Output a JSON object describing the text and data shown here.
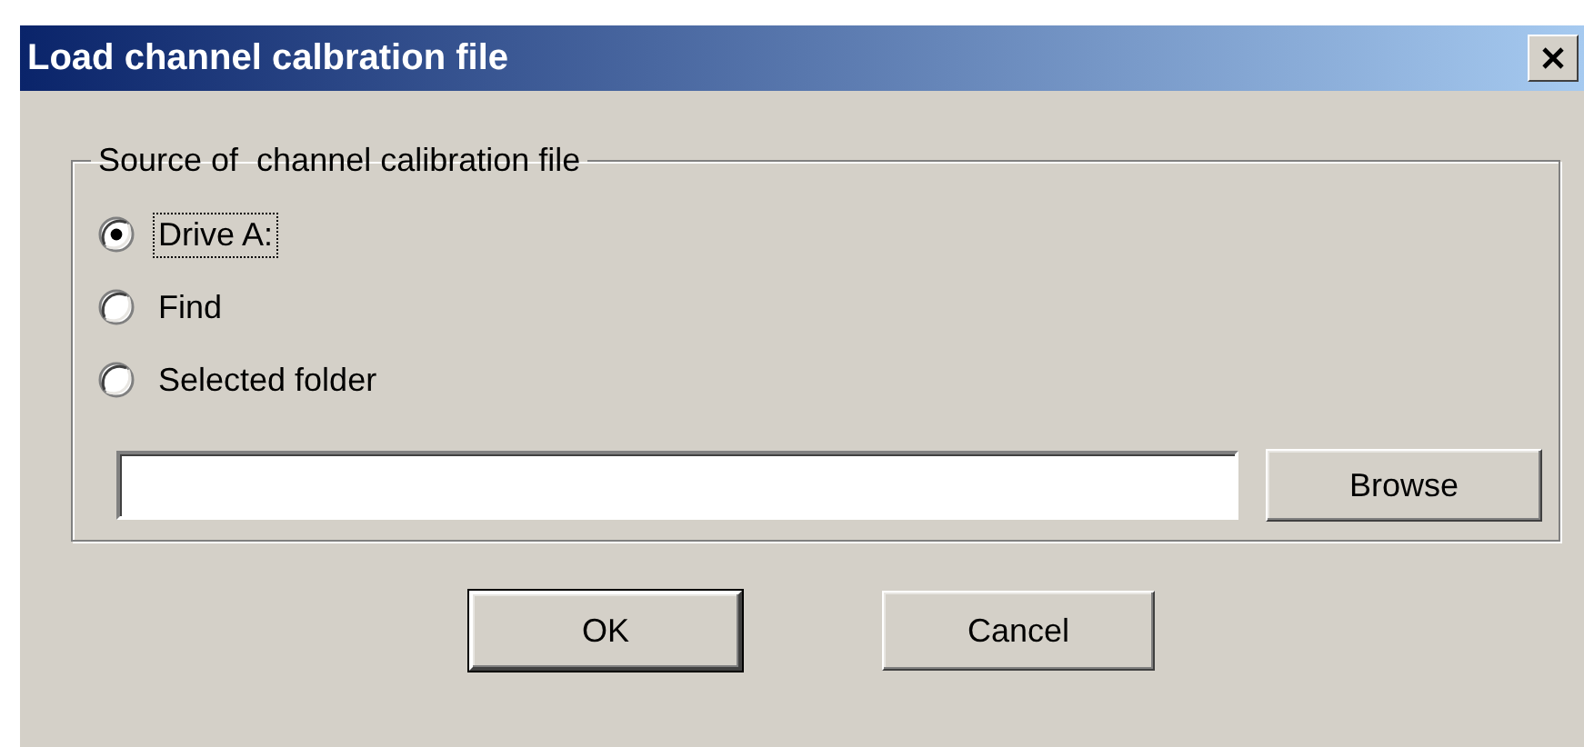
{
  "window": {
    "title": "Load channel calbration file"
  },
  "group": {
    "label": "Source of  channel calibration file",
    "options": [
      {
        "label": "Drive A:",
        "selected": true,
        "focused": true
      },
      {
        "label": "Find",
        "selected": false,
        "focused": false
      },
      {
        "label": "Selected folder",
        "selected": false,
        "focused": false
      }
    ]
  },
  "browse_button": "Browse",
  "buttons": [
    {
      "label": "OK",
      "default": true
    },
    {
      "label": "Cancel",
      "default": false
    }
  ]
}
